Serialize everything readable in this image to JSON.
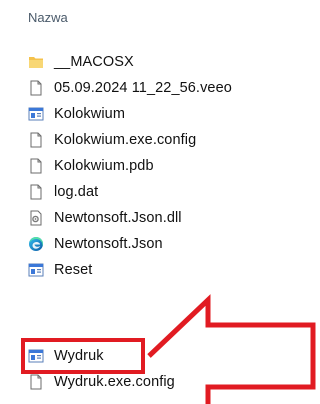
{
  "header": {
    "column_name": "Nazwa"
  },
  "files": [
    {
      "name": "__MACOSX",
      "icon": "folder-icon"
    },
    {
      "name": "05.09.2024 11_22_56.veeo",
      "icon": "file-icon"
    },
    {
      "name": "Kolokwium",
      "icon": "application-icon"
    },
    {
      "name": "Kolokwium.exe.config",
      "icon": "file-icon"
    },
    {
      "name": "Kolokwium.pdb",
      "icon": "file-icon"
    },
    {
      "name": "log.dat",
      "icon": "file-icon"
    },
    {
      "name": "Newtonsoft.Json.dll",
      "icon": "dll-icon"
    },
    {
      "name": "Newtonsoft.Json",
      "icon": "edge-icon"
    },
    {
      "name": "Reset",
      "icon": "application-icon"
    },
    {
      "name": "Wydruk",
      "icon": "application-icon"
    },
    {
      "name": "Wydruk.exe.config",
      "icon": "file-icon"
    }
  ],
  "annotation": {
    "color": "#e11b22"
  }
}
